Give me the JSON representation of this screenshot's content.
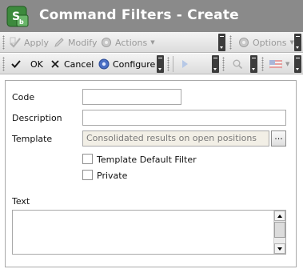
{
  "window": {
    "title": "Command Filters - Create",
    "icon": "app-logo-icon"
  },
  "toolbar1": {
    "apply_label": "Apply",
    "modify_label": "Modify",
    "actions_label": "Actions",
    "options_label": "Options"
  },
  "toolbar2": {
    "ok_label": "OK",
    "cancel_label": "Cancel",
    "configure_label": "Configure"
  },
  "form": {
    "code_label": "Code",
    "code_value": "",
    "description_label": "Description",
    "description_value": "",
    "template_label": "Template",
    "template_value": "Consolidated results on open positions",
    "template_browse_label": "...",
    "template_default_filter_label": "Template Default Filter",
    "template_default_filter_checked": false,
    "private_label": "Private",
    "private_checked": false,
    "text_label": "Text",
    "text_value": ""
  },
  "colors": {
    "titlebar": "#8a8a8a",
    "title_text": "#ffffff",
    "disabled_text": "#9a9a9a",
    "readonly_field": "#f2efe6"
  }
}
